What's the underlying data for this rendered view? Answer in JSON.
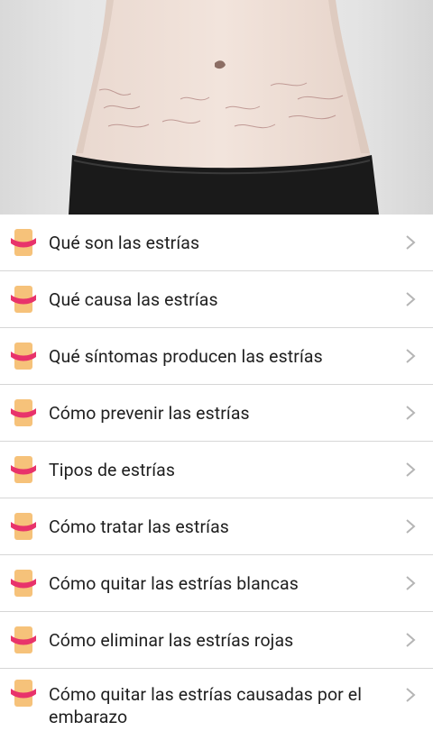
{
  "hero": {
    "image": "stretch-marks-belly-photo"
  },
  "menu": {
    "items": [
      {
        "label": "Qué son las estrías",
        "icon": "belly-icon"
      },
      {
        "label": "Qué causa las estrías",
        "icon": "belly-icon"
      },
      {
        "label": "Qué síntomas producen las estrías",
        "icon": "belly-icon"
      },
      {
        "label": "Cómo prevenir las estrías",
        "icon": "belly-icon"
      },
      {
        "label": "Tipos de estrías",
        "icon": "belly-icon"
      },
      {
        "label": "Cómo tratar las estrías",
        "icon": "belly-icon"
      },
      {
        "label": "Cómo quitar las estrías blancas",
        "icon": "belly-icon"
      },
      {
        "label": "Cómo eliminar las estrías rojas",
        "icon": "belly-icon"
      },
      {
        "label": "Cómo quitar las estrías causadas por el embarazo",
        "icon": "belly-icon"
      }
    ]
  },
  "colors": {
    "divider": "#d6d6d6",
    "chevron": "#b5b5b5",
    "icon_skin": "#f6c27a",
    "icon_band": "#e8336b"
  }
}
